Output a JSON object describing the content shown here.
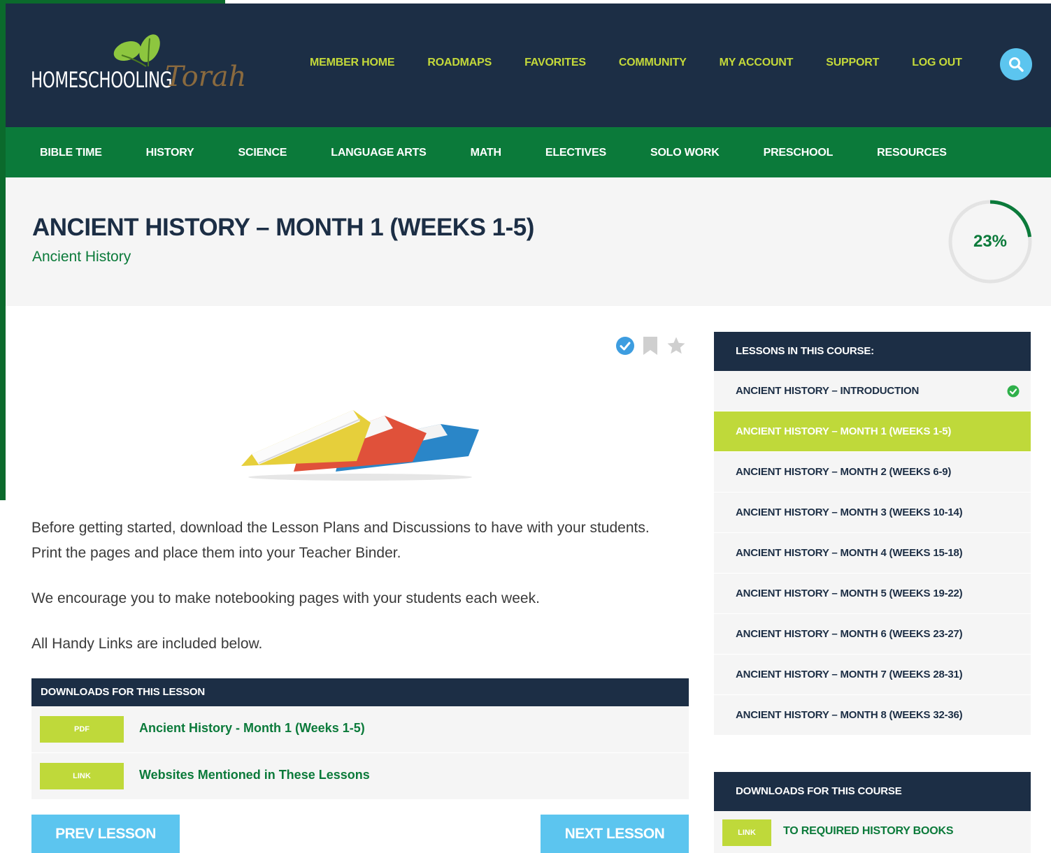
{
  "brand": {
    "logo_text": "HOMESCHOOLING",
    "logo_script": "Torah"
  },
  "topnav": [
    "MEMBER HOME",
    "ROADMAPS",
    "FAVORITES",
    "COMMUNITY",
    "MY ACCOUNT",
    "SUPPORT",
    "LOG OUT"
  ],
  "subnav": [
    "BIBLE TIME",
    "HISTORY",
    "SCIENCE",
    "LANGUAGE ARTS",
    "MATH",
    "ELECTIVES",
    "SOLO WORK",
    "PRESCHOOL",
    "RESOURCES"
  ],
  "page": {
    "title": "ANCIENT HISTORY – MONTH 1 (WEEKS 1-5)",
    "course": "Ancient History",
    "progress_label": "23%",
    "progress_fraction": 0.23
  },
  "content": {
    "paragraphs": [
      "Before getting started, download the Lesson Plans and Discussions to have with your students. Print the pages and place them into your Teacher Binder.",
      "We encourage you to make notebooking pages with your students each week.",
      "All Handy Links are included below."
    ]
  },
  "lesson_downloads": {
    "header": "DOWNLOADS FOR THIS LESSON",
    "items": [
      {
        "badge": "PDF",
        "label": "Ancient History - Month 1 (Weeks 1-5)"
      },
      {
        "badge": "LINK",
        "label": "Websites Mentioned in These Lessons"
      }
    ]
  },
  "buttons": {
    "prev": "PREV LESSON",
    "next": "NEXT LESSON"
  },
  "sidebar": {
    "header": "LESSONS IN THIS COURSE:",
    "lessons": [
      "ANCIENT HISTORY – INTRODUCTION",
      "ANCIENT HISTORY – MONTH 1 (WEEKS 1-5)",
      "ANCIENT HISTORY – MONTH 2 (WEEKS 6-9)",
      "ANCIENT HISTORY – MONTH 3 (WEEKS 10-14)",
      "ANCIENT HISTORY – MONTH 4 (WEEKS 15-18)",
      "ANCIENT HISTORY – MONTH 5 (WEEKS 19-22)",
      "ANCIENT HISTORY – MONTH 6 (WEEKS 23-27)",
      "ANCIENT HISTORY – MONTH 7 (WEEKS 28-31)",
      "ANCIENT HISTORY – MONTH 8 (WEEKS 32-36)"
    ],
    "course_downloads_header": "DOWNLOADS FOR THIS COURSE",
    "course_downloads": [
      {
        "badge": "LINK",
        "label": "TO REQUIRED HISTORY BOOKS"
      }
    ]
  },
  "colors": {
    "navy": "#1c2e45",
    "green": "#0b7a3a",
    "lime": "#bfd93a",
    "sky": "#5cc5ef",
    "nav_text": "#c4d93a"
  },
  "icons": [
    "search-icon",
    "check-circle-icon",
    "bookmark-icon",
    "star-icon",
    "binders-image"
  ]
}
